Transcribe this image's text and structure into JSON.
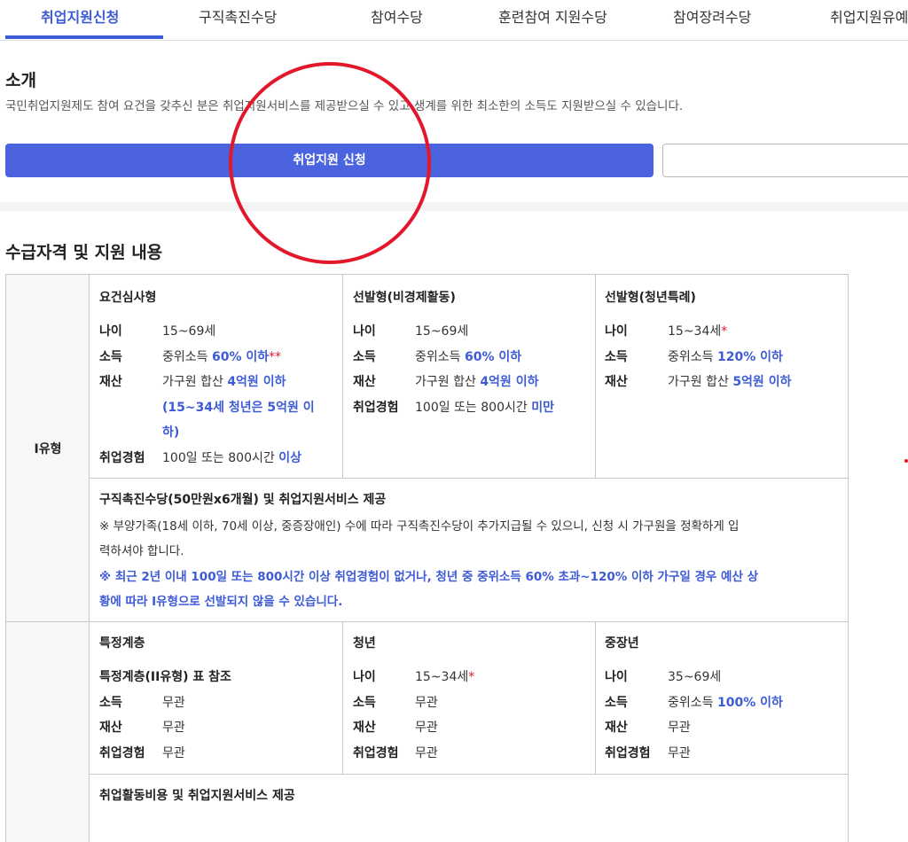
{
  "tabs": [
    "취업지원신청",
    "구직촉진수당",
    "참여수당",
    "훈련참여 지원수당",
    "참여장려수당",
    "취업지원유예"
  ],
  "intro": {
    "title": "소개",
    "text": "국민취업지원제도 참여 요건을 갖추신 분은 취업지원서비스를 제공받으실 수 있고 생계를 위한 최소한의 소득도 지원받으실 수 있습니다.",
    "apply_button": "취업지원 신청"
  },
  "eligibility": {
    "title": "수급자격 및 지원 내용",
    "type1": {
      "label": "I유형",
      "col1": {
        "title": "요건심사형",
        "age_label": "나이",
        "age": "15~69세",
        "income_label": "소득",
        "income_pre": "중위소득 ",
        "income_hl": "60% 이하",
        "income_star": "**",
        "asset_label": "재산",
        "asset_pre": "가구원 합산 ",
        "asset_hl": "4억원 이하",
        "asset_note1": "(15~34세 청년은 5억원 이",
        "asset_note2": "하)",
        "exp_label": "취업경험",
        "exp_pre": "100일 또는 800시간 ",
        "exp_hl": "이상"
      },
      "col2": {
        "title": "선발형(비경제활동)",
        "age_label": "나이",
        "age": "15~69세",
        "income_label": "소득",
        "income_pre": "중위소득 ",
        "income_hl": "60% 이하",
        "asset_label": "재산",
        "asset_pre": "가구원 합산 ",
        "asset_hl": "4억원 이하",
        "exp_label": "취업경험",
        "exp_pre": "100일 또는 800시간 ",
        "exp_hl": "미만"
      },
      "col3": {
        "title": "선발형(청년특례)",
        "age_label": "나이",
        "age": "15~34세",
        "age_star": "*",
        "income_label": "소득",
        "income_pre": "중위소득 ",
        "income_hl": "120% 이하",
        "asset_label": "재산",
        "asset_pre": "가구원 합산 ",
        "asset_hl": "5억원 이하"
      },
      "benefit": {
        "title": "구직촉진수당(50만원x6개월) 및 취업지원서비스 제공",
        "note1a": "※ 부양가족(18세 이하, 70세 이상, 중증장애인) 수에 따라 구직촉진수당이 추가지급될 수 있으니, 신청 시 가구원을 정확하게 입",
        "note1b": "력하셔야 합니다.",
        "note2a": "※ 최근 2년 이내 100일 또는 800시간 이상 취업경험이 없거나, 청년 중 중위소득 60% 초과~120% 이하 가구일 경우 예산 상",
        "note2b": "황에 따라 I유형으로 선발되지 않을 수 있습니다."
      }
    },
    "type2": {
      "col1": {
        "title": "특정계층",
        "sub": "특정계층(II유형) 표 참조",
        "income_label": "소득",
        "income": "무관",
        "asset_label": "재산",
        "asset": "무관",
        "exp_label": "취업경험",
        "exp": "무관"
      },
      "col2": {
        "title": "청년",
        "age_label": "나이",
        "age": "15~34세",
        "age_star": "*",
        "income_label": "소득",
        "income": "무관",
        "asset_label": "재산",
        "asset": "무관",
        "exp_label": "취업경험",
        "exp": "무관"
      },
      "col3": {
        "title": "중장년",
        "age_label": "나이",
        "age": "35~69세",
        "income_label": "소득",
        "income_pre": "중위소득 ",
        "income_hl": "100% 이하",
        "asset_label": "재산",
        "asset": "무관",
        "exp_label": "취업경험",
        "exp": "무관"
      },
      "benefit": {
        "title": "취업활동비용 및 취업지원서비스 제공"
      }
    }
  },
  "colors": {
    "accent": "#3e5bd6",
    "button": "#4b63de",
    "annotation": "#e2182a"
  }
}
